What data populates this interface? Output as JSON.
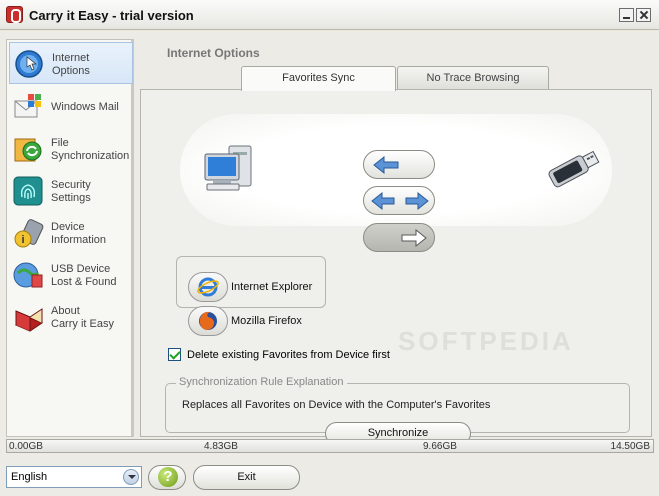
{
  "window": {
    "title": "Carry it Easy - trial version"
  },
  "sidebar": {
    "items": [
      {
        "label": "Internet\nOptions",
        "icon": "internet-options-icon"
      },
      {
        "label": "Windows Mail",
        "icon": "windows-mail-icon"
      },
      {
        "label": "File\nSynchronization",
        "icon": "file-sync-icon"
      },
      {
        "label": "Security\nSettings",
        "icon": "security-fingerprint-icon"
      },
      {
        "label": "Device\nInformation",
        "icon": "device-info-icon"
      },
      {
        "label": "USB Device\nLost & Found",
        "icon": "lost-found-icon"
      },
      {
        "label": "About\nCarry it Easy",
        "icon": "about-book-icon"
      }
    ]
  },
  "main": {
    "section_title": "Internet Options",
    "tabs": [
      {
        "label": "Favorites Sync",
        "active": true
      },
      {
        "label": "No Trace Browsing",
        "active": false
      }
    ],
    "sync_directions": [
      "arrow-left-icon",
      "arrow-both-icon",
      "arrow-right-icon"
    ],
    "selected_direction": "arrow-right-icon",
    "browsers": [
      {
        "label": "Internet Explorer",
        "icon": "internet-explorer-icon"
      },
      {
        "label": "Mozilla Firefox",
        "icon": "firefox-icon"
      }
    ],
    "checkbox": {
      "label": "Delete existing Favorites from Device first",
      "checked": true
    },
    "rule": {
      "legend": "Synchronization Rule Explanation",
      "text": "Replaces all Favorites on Device with the Computer's Favorites"
    },
    "synchronize_label": "Synchronize",
    "watermark": "SOFTPEDIA"
  },
  "capacity": {
    "labels": [
      "0.00GB",
      "4.83GB",
      "9.66GB",
      "14.50GB"
    ]
  },
  "footer": {
    "language": "English",
    "help_label": "?",
    "exit_label": "Exit"
  },
  "colors": {
    "accent": "#2b6fc2",
    "brand": "#c9302c"
  }
}
